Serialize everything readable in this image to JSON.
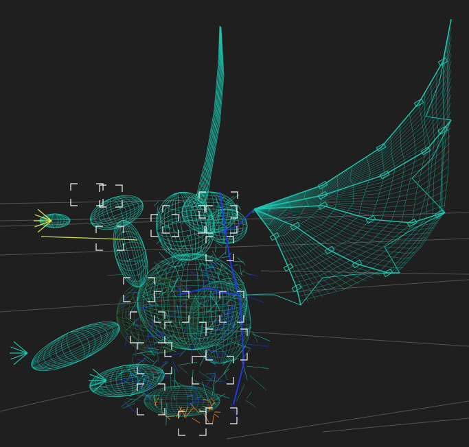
{
  "viewport": {
    "background": "#1f1f1f",
    "view": "perspective",
    "shading": "wireframe",
    "grid_visible": true
  },
  "model": {
    "description_icon": "winged-creature-wireframe",
    "wire_color_primary": "#1fc9b2",
    "wire_color_secondary": "#1a8f7a",
    "wire_color_tertiary": "#2a6a3a",
    "rig_color_bones": "#1e3cff",
    "rig_color_selected": "#ff8a1c",
    "rig_color_highlight": "#e8f24a",
    "bounding_bracket_color": "#ffffff"
  },
  "grid": {
    "color": "#5a5a5a"
  }
}
